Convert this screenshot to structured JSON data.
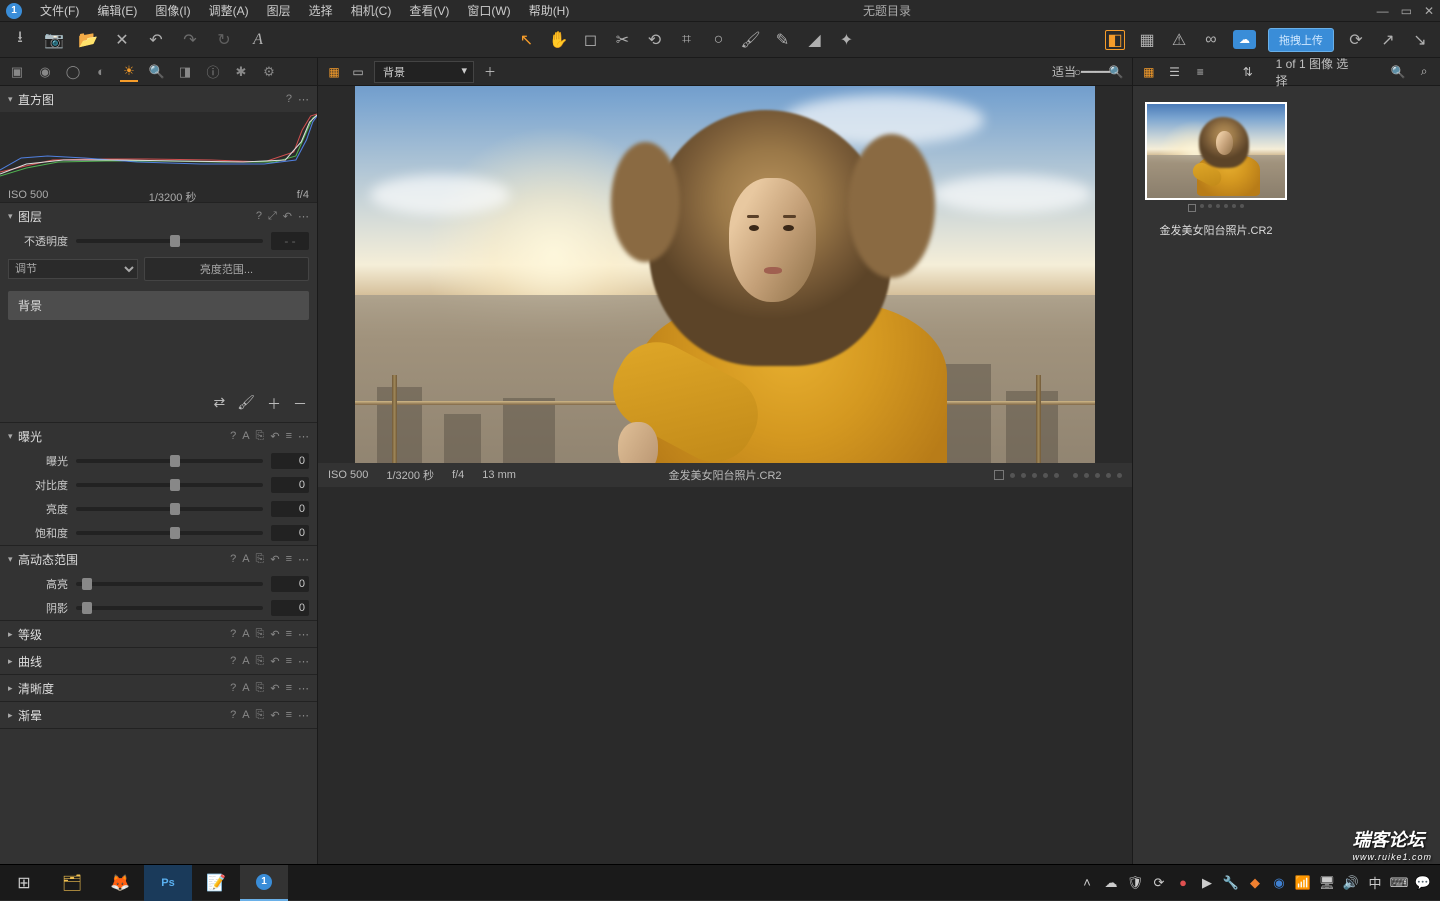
{
  "menubar": {
    "title": "无题目录",
    "items": [
      "文件(F)",
      "编辑(E)",
      "图像(I)",
      "调整(A)",
      "图层",
      "选择",
      "相机(C)",
      "查看(V)",
      "窗口(W)",
      "帮助(H)"
    ]
  },
  "toolbar": {
    "upload": "拖拽上传"
  },
  "centerTop": {
    "layerDropdown": "背景",
    "fitLabel": "适当"
  },
  "rightTop": {
    "countLabel": "1 of 1 图像 选择"
  },
  "histogram": {
    "title": "直方图",
    "iso": "ISO 500",
    "shutter": "1/3200 秒",
    "aperture": "f/4"
  },
  "layers": {
    "title": "图层",
    "opacity": "不透明度",
    "adjustSelect": "调节",
    "luminosity": "亮度范围...",
    "bgLayer": "背景"
  },
  "exposure": {
    "title": "曝光",
    "rows": [
      {
        "lbl": "曝光",
        "val": "0",
        "pos": 50
      },
      {
        "lbl": "对比度",
        "val": "0",
        "pos": 50
      },
      {
        "lbl": "亮度",
        "val": "0",
        "pos": 50
      },
      {
        "lbl": "饱和度",
        "val": "0",
        "pos": 50
      }
    ]
  },
  "hdr": {
    "title": "高动态范围",
    "rows": [
      {
        "lbl": "高亮",
        "val": "0",
        "pos": 3
      },
      {
        "lbl": "阴影",
        "val": "0",
        "pos": 3
      }
    ]
  },
  "collapsed": [
    {
      "title": "等级"
    },
    {
      "title": "曲线"
    },
    {
      "title": "清晰度"
    },
    {
      "title": "渐晕"
    }
  ],
  "footer": {
    "iso": "ISO 500",
    "shutter": "1/3200 秒",
    "aperture": "f/4",
    "focal": "13 mm",
    "filename": "金发美女阳台照片.CR2"
  },
  "thumb": {
    "name": "金发美女阳台照片.CR2"
  },
  "tray": {
    "ime": "中",
    "time": "",
    "date": ""
  },
  "watermark": {
    "line1": "瑞客论坛",
    "line2": "www.ruike1.com"
  }
}
